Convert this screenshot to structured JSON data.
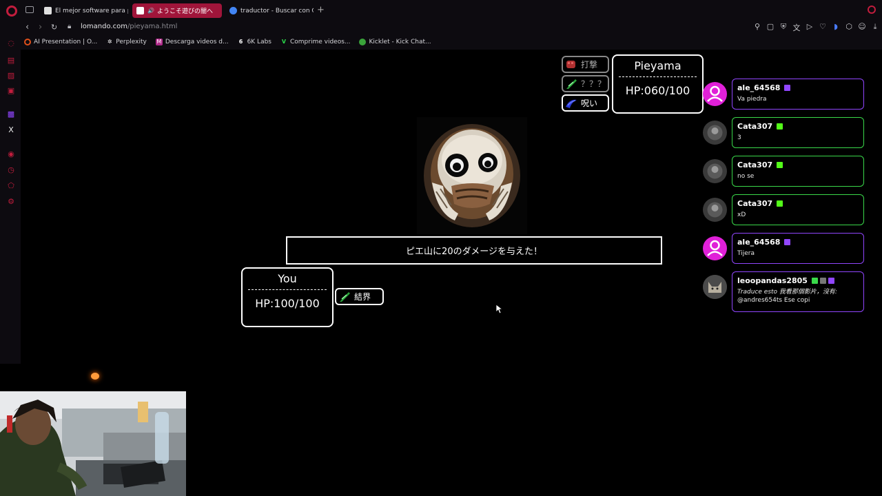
{
  "browser": {
    "tabs": [
      {
        "label": "El mejor software para pote",
        "active": false,
        "favicon_color": "#e0e0e0"
      },
      {
        "label": "ようこそ遊びの闇へ",
        "active": true,
        "favicon_color": "#ffffff"
      },
      {
        "label": "traductor - Buscar con Goo",
        "active": false,
        "favicon_color": "#4285f4"
      }
    ],
    "url_domain": "lomando.com",
    "url_path": "/pieyama.html",
    "bookmarks": [
      {
        "label": "AI Presentation | O...",
        "color": "#e0501a"
      },
      {
        "label": "Perplexity",
        "color": "#333333"
      },
      {
        "label": "Descarga videos d...",
        "color": "#b02a8a"
      },
      {
        "label": "6K Labs",
        "color": "#222222"
      },
      {
        "label": "Comprime videos...",
        "color": "#2aa33a"
      },
      {
        "label": "Kicklet - Kick Chat...",
        "color": "#3aa33a"
      }
    ],
    "accent": "#c21d3d"
  },
  "game": {
    "enemy": {
      "name": "Pieyama",
      "hp": "HP:060/100"
    },
    "player": {
      "name": "You",
      "hp": "HP:100/100"
    },
    "enemy_skills": [
      {
        "label": "打撃",
        "dim": true
      },
      {
        "label": "？？？",
        "dim": true
      },
      {
        "label": "呪い",
        "dim": false
      }
    ],
    "player_skills": [
      {
        "label": "結界"
      }
    ],
    "message": "ピエ山に20のダメージを与えた！"
  },
  "chat": [
    {
      "user": "ale_64568",
      "message": "Va piedra",
      "avatar": "pink",
      "platform": "twitch",
      "extra_badges": []
    },
    {
      "user": "Cata307",
      "message": "3",
      "avatar": "gray",
      "platform": "kick",
      "extra_badges": []
    },
    {
      "user": "Cata307",
      "message": "no se",
      "avatar": "gray",
      "platform": "kick",
      "extra_badges": []
    },
    {
      "user": "Cata307",
      "message": "xD",
      "avatar": "gray",
      "platform": "kick",
      "extra_badges": []
    },
    {
      "user": "ale_64568",
      "message": "Tijera",
      "avatar": "pink",
      "platform": "twitch",
      "extra_badges": []
    },
    {
      "user": "leoopandas2805",
      "message_italic": "Traduce esto 我看那個影片，沒有:",
      "message": "@andres654ts Ese copi",
      "avatar": "gray",
      "platform": "twitch",
      "extra_badges": [
        "check",
        "gray"
      ]
    }
  ]
}
